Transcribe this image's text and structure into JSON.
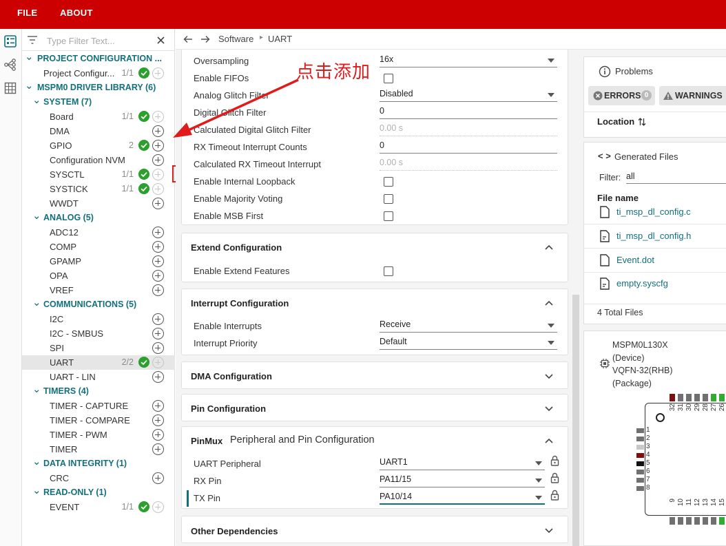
{
  "menu": {
    "file": "FILE",
    "about": "ABOUT"
  },
  "sidebar": {
    "filter_placeholder": "Type Filter Text...",
    "rows": [
      {
        "label": "PROJECT CONFIGURATION ...",
        "type": "section"
      },
      {
        "label": "Project Configur...",
        "count": "1/1",
        "ok": true
      },
      {
        "label": "MSPM0 DRIVER LIBRARY (6)",
        "type": "section"
      },
      {
        "label": "SYSTEM (7)",
        "type": "group"
      },
      {
        "label": "Board",
        "count": "1/1",
        "ok": true
      },
      {
        "label": "DMA"
      },
      {
        "label": "GPIO",
        "count": "2",
        "ok": true
      },
      {
        "label": "Configuration NVM"
      },
      {
        "label": "SYSCTL",
        "count": "1/1",
        "ok": true
      },
      {
        "label": "SYSTICK",
        "count": "1/1",
        "ok": true
      },
      {
        "label": "WWDT"
      },
      {
        "label": "ANALOG (5)",
        "type": "group"
      },
      {
        "label": "ADC12"
      },
      {
        "label": "COMP"
      },
      {
        "label": "GPAMP"
      },
      {
        "label": "OPA"
      },
      {
        "label": "VREF"
      },
      {
        "label": "COMMUNICATIONS (5)",
        "type": "group"
      },
      {
        "label": "I2C"
      },
      {
        "label": "I2C - SMBUS"
      },
      {
        "label": "SPI"
      },
      {
        "label": "UART",
        "count": "2/2",
        "ok": true,
        "selected": true
      },
      {
        "label": "UART - LIN"
      },
      {
        "label": "TIMERS (4)",
        "type": "group"
      },
      {
        "label": "TIMER - CAPTURE"
      },
      {
        "label": "TIMER - COMPARE"
      },
      {
        "label": "TIMER - PWM"
      },
      {
        "label": "TIMER"
      },
      {
        "label": "DATA INTEGRITY (1)",
        "type": "group"
      },
      {
        "label": "CRC"
      },
      {
        "label": "READ-ONLY (1)",
        "type": "group"
      },
      {
        "label": "EVENT",
        "count": "1/1",
        "ok": true
      }
    ]
  },
  "breadcrumb": {
    "part1": "Software",
    "part2": "UART"
  },
  "annotation": "点击添加",
  "config": {
    "basic_fields": [
      {
        "label": "Oversampling",
        "value": "16x",
        "kind": "select"
      },
      {
        "label": "Enable FIFOs",
        "kind": "check"
      },
      {
        "label": "Analog Glitch Filter",
        "value": "Disabled",
        "kind": "select"
      },
      {
        "label": "Digital Glitch Filter",
        "value": "0",
        "kind": "text"
      },
      {
        "label": "Calculated Digital Glitch Filter",
        "value": "0.00 s",
        "kind": "readonly"
      },
      {
        "label": "RX Timeout Interrupt Counts",
        "value": "0",
        "kind": "text"
      },
      {
        "label": "Calculated RX Timeout Interrupt",
        "value": "0.00 s",
        "kind": "readonly"
      },
      {
        "label": "Enable Internal Loopback",
        "kind": "check"
      },
      {
        "label": "Enable Majority Voting",
        "kind": "check"
      },
      {
        "label": "Enable MSB First",
        "kind": "check"
      }
    ],
    "extend": {
      "title": "Extend Configuration",
      "field": "Enable Extend Features"
    },
    "interrupt": {
      "title": "Interrupt Configuration",
      "fields": [
        {
          "label": "Enable Interrupts",
          "value": "Receive"
        },
        {
          "label": "Interrupt Priority",
          "value": "Default"
        }
      ]
    },
    "dma_title": "DMA Configuration",
    "pin_title": "Pin Configuration",
    "pinmux": {
      "title": "PinMux",
      "subtitle": "Peripheral and Pin Configuration",
      "fields": [
        {
          "label": "UART Peripheral",
          "value": "UART1"
        },
        {
          "label": "RX Pin",
          "value": "PA11/15"
        },
        {
          "label": "TX Pin",
          "value": "PA10/14"
        }
      ]
    },
    "other_title": "Other Dependencies"
  },
  "problems": {
    "title": "Problems",
    "errors_label": "ERRORS",
    "errors_count": "0",
    "warnings_label": "WARNINGS",
    "location_label": "Location"
  },
  "generated": {
    "title": "Generated Files",
    "filter_label": "Filter:",
    "filter_value": "all",
    "column": "File name",
    "files": [
      "ti_msp_dl_config.c",
      "ti_msp_dl_config.h",
      "Event.dot",
      "empty.syscfg"
    ],
    "total": "4 Total Files"
  },
  "device": {
    "line1": "MSPM0L130X",
    "line2": "(Device)",
    "line3": "VQFN-32(RHB)",
    "line4": "(Package)",
    "top_pins": [
      "32",
      "31",
      "30",
      "29",
      "28",
      "27",
      "26"
    ],
    "left_pins": [
      "1",
      "2",
      "3",
      "4",
      "5",
      "6",
      "7",
      "8"
    ],
    "bottom_pins": [
      "9",
      "10",
      "11",
      "12",
      "13",
      "14",
      "15"
    ]
  },
  "colors": {
    "brand": "#cc0000",
    "accent": "#11707c",
    "ok": "#2ca02c",
    "annotation": "#e01b1b"
  }
}
